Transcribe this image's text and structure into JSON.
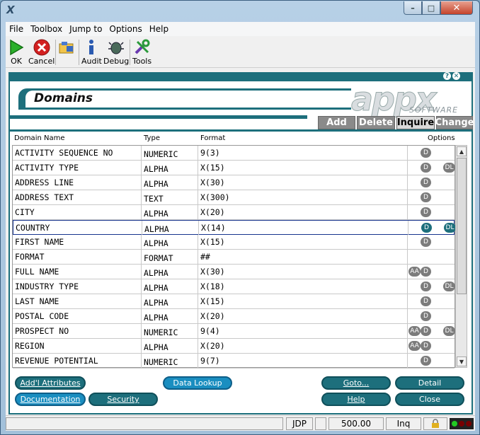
{
  "window": {
    "icon_glyph": "X",
    "minimize": "–",
    "maximize": "□",
    "close": "✕"
  },
  "menu": [
    "File",
    "Toolbox",
    "Jump to",
    "Options",
    "Help"
  ],
  "toolbar": [
    {
      "label": "OK",
      "icon": "play-icon"
    },
    {
      "label": "Cancel",
      "icon": "cancel-icon"
    },
    {
      "label": "",
      "icon": "folder-icon"
    },
    {
      "label": "Audit",
      "icon": "info-icon"
    },
    {
      "label": "Debug",
      "icon": "bug-icon"
    },
    {
      "label": "Tools",
      "icon": "tools-icon"
    }
  ],
  "panel": {
    "help_btn": "?",
    "close_btn": "✕",
    "title": "Domains",
    "logo_text": "appx",
    "logo_sub": "SOFTWARE",
    "modes": [
      {
        "label": "Add",
        "active": false
      },
      {
        "label": "Delete",
        "active": false
      },
      {
        "label": "Inquire",
        "active": true
      },
      {
        "label": "Change",
        "active": false
      }
    ]
  },
  "grid": {
    "columns": {
      "name": "Domain Name",
      "type": "Type",
      "format": "Format",
      "options": "Options"
    },
    "rows": [
      {
        "name": "ACTIVITY SEQUENCE NO",
        "type": "NUMERIC",
        "format": "9(3)",
        "opts": [
          "D"
        ]
      },
      {
        "name": "ACTIVITY TYPE",
        "type": "ALPHA",
        "format": "X(15)",
        "opts": [
          "D",
          "DL"
        ]
      },
      {
        "name": "ADDRESS LINE",
        "type": "ALPHA",
        "format": "X(30)",
        "opts": [
          "D"
        ]
      },
      {
        "name": "ADDRESS TEXT",
        "type": "TEXT",
        "format": "X(300)",
        "opts": [
          "D"
        ]
      },
      {
        "name": "CITY",
        "type": "ALPHA",
        "format": "X(20)",
        "opts": [
          "D"
        ]
      },
      {
        "name": "COUNTRY",
        "type": "ALPHA",
        "format": "X(14)",
        "opts": [
          "D",
          "DL"
        ],
        "selected": true
      },
      {
        "name": "FIRST NAME",
        "type": "ALPHA",
        "format": "X(15)",
        "opts": [
          "D"
        ]
      },
      {
        "name": "FORMAT",
        "type": "FORMAT",
        "format": "##",
        "opts": []
      },
      {
        "name": "FULL NAME",
        "type": "ALPHA",
        "format": "X(30)",
        "opts": [
          "AA",
          "D"
        ]
      },
      {
        "name": "INDUSTRY TYPE",
        "type": "ALPHA",
        "format": "X(18)",
        "opts": [
          "D",
          "DL"
        ]
      },
      {
        "name": "LAST NAME",
        "type": "ALPHA",
        "format": "X(15)",
        "opts": [
          "D"
        ]
      },
      {
        "name": "POSTAL CODE",
        "type": "ALPHA",
        "format": "X(20)",
        "opts": [
          "D"
        ]
      },
      {
        "name": "PROSPECT NO",
        "type": "NUMERIC",
        "format": "9(4)",
        "opts": [
          "AA",
          "D",
          "DL"
        ]
      },
      {
        "name": "REGION",
        "type": "ALPHA",
        "format": "X(20)",
        "opts": [
          "AA",
          "D"
        ]
      },
      {
        "name": "REVENUE POTENTIAL",
        "type": "NUMERIC",
        "format": "9(7)",
        "opts": [
          "D"
        ]
      }
    ]
  },
  "buttons": {
    "addl_attributes": "Add'l Attributes",
    "documentation": "Documentation",
    "security": "Security",
    "data_lookup": "Data Lookup",
    "goto": "Goto...",
    "detail": "Detail",
    "help": "Help",
    "close": "Close"
  },
  "status": {
    "user": "JDP",
    "version": "500.00",
    "mode": "Inq"
  },
  "colors": {
    "accent": "#1d6f7c",
    "selected_border": "#16348e",
    "pill_blue": "#1a8ec0"
  }
}
